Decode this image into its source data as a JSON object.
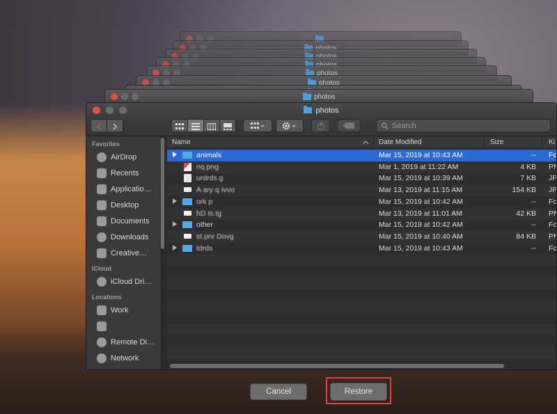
{
  "stack_windows": [
    {
      "title": ""
    },
    {
      "title": "photos"
    },
    {
      "title": "photos"
    },
    {
      "title": "photos"
    },
    {
      "title": "photos"
    },
    {
      "title": "photos"
    },
    {
      "title": "photos"
    },
    {
      "title": "photos"
    }
  ],
  "window": {
    "title": "photos"
  },
  "toolbar": {
    "back_label": "<",
    "forward_label": ">",
    "search_placeholder": "Search"
  },
  "sidebar": {
    "favorites_header": "Favorites",
    "favorites": [
      {
        "label": "AirDrop",
        "icon": "airdrop-icon"
      },
      {
        "label": "Recents",
        "icon": "recents-icon"
      },
      {
        "label": "Applicatio…",
        "icon": "applications-icon"
      },
      {
        "label": "Desktop",
        "icon": "desktop-icon"
      },
      {
        "label": "Documents",
        "icon": "documents-icon"
      },
      {
        "label": "Downloads",
        "icon": "downloads-icon"
      },
      {
        "label": "Creative…",
        "icon": "folder-icon"
      }
    ],
    "icloud_header": "iCloud",
    "icloud": [
      {
        "label": "iCloud Dri…",
        "icon": "cloud-icon"
      }
    ],
    "locations_header": "Locations",
    "locations": [
      {
        "label": "Work",
        "icon": "drive-icon"
      },
      {
        "label": "",
        "icon": "drive-icon"
      },
      {
        "label": "Remote Di…",
        "icon": "disc-icon"
      },
      {
        "label": "Network",
        "icon": "network-icon"
      }
    ]
  },
  "columns": {
    "name": "Name",
    "date": "Date Modified",
    "size": "Size",
    "kind": "Ki"
  },
  "files": [
    {
      "name": "animals",
      "date": "Mar 15, 2019 at 10:43 AM",
      "size": "--",
      "kind": "Fo",
      "type": "folder",
      "selected": true
    },
    {
      "name": "nq.png",
      "date": "Mar 1, 2019 at 11:22 AM",
      "size": "4 KB",
      "kind": "PN",
      "type": "image-red"
    },
    {
      "name": "urdrds.g",
      "date": "Mar 15, 2019 at 10:39 AM",
      "size": "7 KB",
      "kind": "JP",
      "type": "image"
    },
    {
      "name": "A     ary    q  Ivvo",
      "date": "Mar 13, 2019 at 11:15 AM",
      "size": "154 KB",
      "kind": "JP",
      "type": "doc"
    },
    {
      "name": "ork        p",
      "date": "Mar 15, 2019 at 10:42 AM",
      "size": "--",
      "kind": "Fo",
      "type": "folder"
    },
    {
      "name": "hD ts.tg",
      "date": "Mar 13, 2019 at 11:01 AM",
      "size": "42 KB",
      "kind": "PN",
      "type": "doc"
    },
    {
      "name": "other",
      "date": "Mar 15, 2019 at 10:42 AM",
      "size": "--",
      "kind": "Fo",
      "type": "folder"
    },
    {
      "name": "st.pnr Dovg",
      "date": "Mar 15, 2019 at 10:40 AM",
      "size": "84 KB",
      "kind": "PN",
      "type": "doc"
    },
    {
      "name": "tdrds",
      "date": "Mar 15, 2019 at 10:43 AM",
      "size": "--",
      "kind": "Fo",
      "type": "folder"
    }
  ],
  "buttons": {
    "cancel": "Cancel",
    "restore": "Restore"
  }
}
